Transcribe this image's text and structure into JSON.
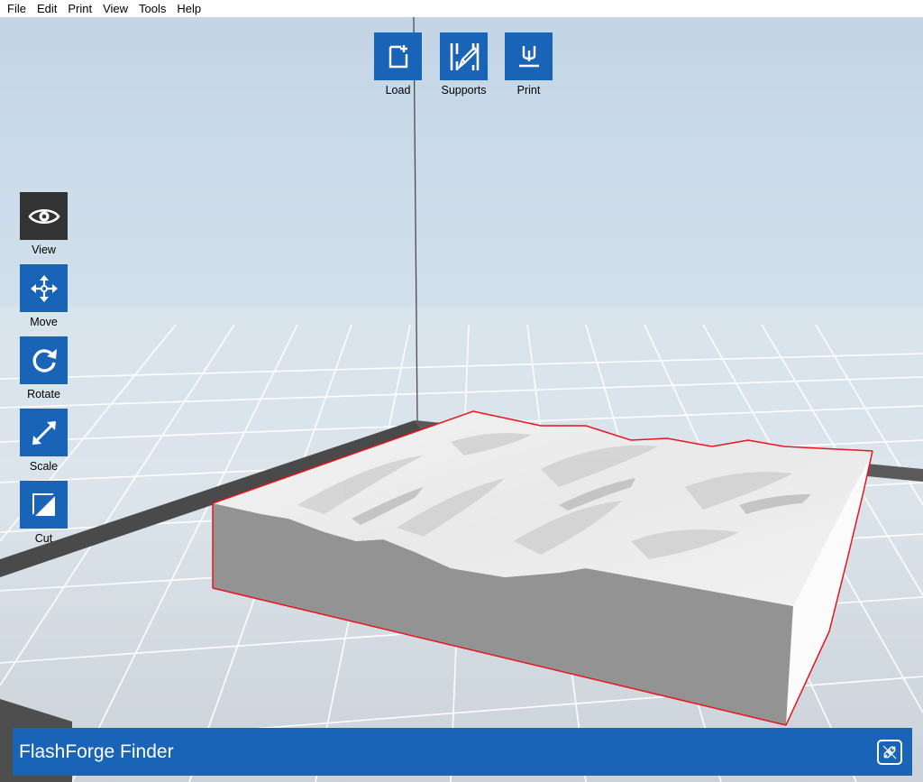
{
  "menu": [
    "File",
    "Edit",
    "Print",
    "View",
    "Tools",
    "Help"
  ],
  "top_toolbar": {
    "load": {
      "label": "Load",
      "icon": "file-add-icon"
    },
    "supports": {
      "label": "Supports",
      "icon": "supports-pencil-icon"
    },
    "print": {
      "label": "Print",
      "icon": "print-nozzle-icon"
    }
  },
  "side_toolbar": {
    "view": {
      "label": "View",
      "icon": "eye-icon",
      "active": true
    },
    "move": {
      "label": "Move",
      "icon": "move-arrows-icon"
    },
    "rotate": {
      "label": "Rotate",
      "icon": "rotate-icon"
    },
    "scale": {
      "label": "Scale",
      "icon": "scale-diagonal-icon"
    },
    "cut": {
      "label": "Cut",
      "icon": "cut-icon"
    }
  },
  "status": {
    "printer_name": "FlashForge Finder",
    "connect_icon": "connect-plug-icon"
  },
  "colors": {
    "accent": "#1a64b8",
    "active_tool": "#333333",
    "selection_outline": "#e8141e",
    "background_sky": "#c9dae8"
  }
}
